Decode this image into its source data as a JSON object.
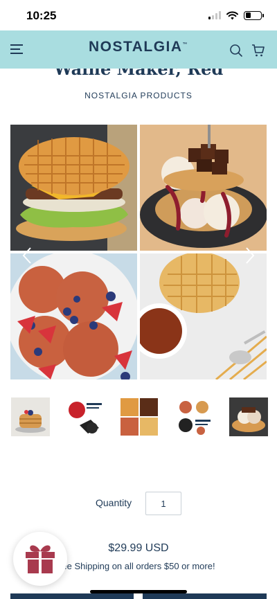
{
  "status_bar": {
    "time": "10:25"
  },
  "header": {
    "brand": "NOSTALGIA",
    "trademark": "™"
  },
  "product": {
    "title": "Waffle Maker, Red",
    "vendor": "NOSTALGIA PRODUCTS",
    "price": "$29.99 USD",
    "shipping_note": "ee Shipping on all orders $50 or more!"
  },
  "gallery": {
    "images": [
      {
        "name": "waffle-burger"
      },
      {
        "name": "waffle-sundae"
      },
      {
        "name": "blueberry-waffles"
      },
      {
        "name": "waffles-with-sauce"
      }
    ],
    "thumbnails": [
      {
        "name": "pancake-stack"
      },
      {
        "name": "compact-waffle-maker"
      },
      {
        "name": "waffle-collage"
      },
      {
        "name": "ready-set-waffle"
      },
      {
        "name": "waffle-ice-cream"
      }
    ]
  },
  "quantity": {
    "label": "Quantity",
    "value": "1"
  },
  "colors": {
    "header_bg": "#a9dde0",
    "brand_navy": "#1f3a57",
    "gift_red": "#a83a4e"
  }
}
